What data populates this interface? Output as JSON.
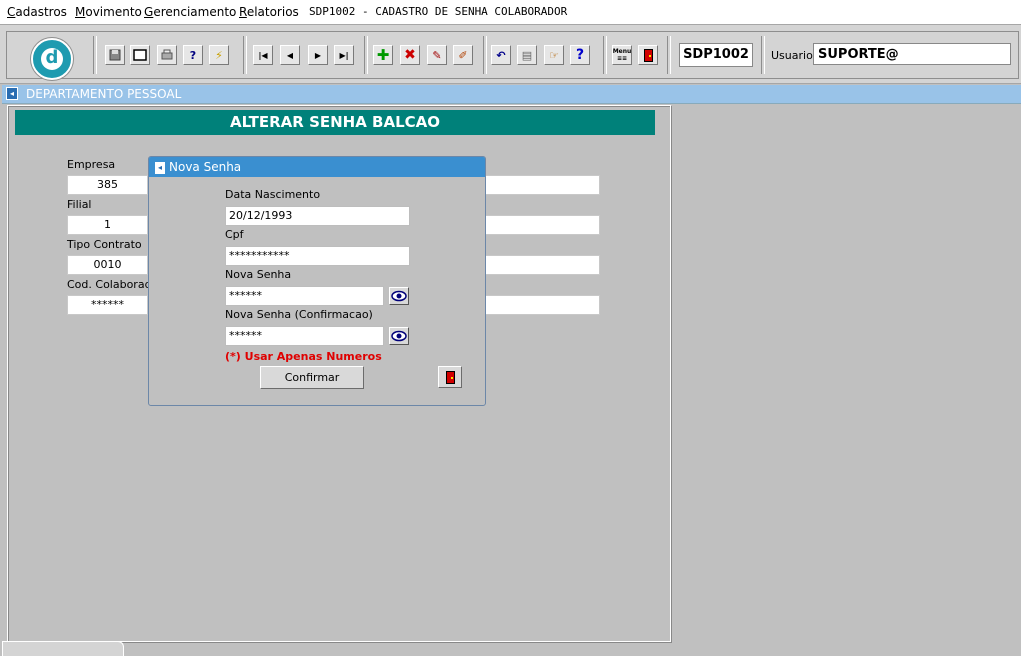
{
  "menu": {
    "items": [
      "Cadastros",
      "Movimento",
      "Gerenciamento",
      "Relatorios"
    ],
    "window_title": "SDP1002 - CADASTRO DE SENHA COLABORADOR"
  },
  "toolbar": {
    "logo_letter": "d",
    "form_code": "SDP1002",
    "user_label": "Usuario",
    "user_value": "SUPORTE@",
    "menu_icon_text": "Menu",
    "buttons": [
      "save-icon",
      "window-icon",
      "print-icon",
      "query-icon",
      "run-icon",
      "first-record-icon",
      "previous-record-icon",
      "next-record-icon",
      "last-record-icon",
      "add-record-icon",
      "delete-record-icon",
      "edit-record-icon",
      "clear-icon",
      "undo-icon",
      "clipboard-icon",
      "help-hand-icon",
      "help-icon",
      "menu-icon",
      "exit-icon"
    ]
  },
  "department": {
    "title": "DEPARTAMENTO PESSOAL"
  },
  "main": {
    "banner": "ALTERAR SENHA BALCAO",
    "fields": {
      "empresa": {
        "label": "Empresa",
        "value": "385"
      },
      "filial": {
        "label": "Filial",
        "value": "1"
      },
      "tipo_contrato": {
        "label": "Tipo Contrato",
        "value": "0010"
      },
      "cod_colaborador": {
        "label": "Cod. Colaborador",
        "value": "******"
      }
    }
  },
  "dialog": {
    "title": "Nova Senha",
    "data_nascimento": {
      "label": "Data Nascimento",
      "value": "20/12/1993"
    },
    "cpf": {
      "label": "Cpf",
      "value": "***********"
    },
    "nova_senha": {
      "label": "Nova Senha",
      "value": "******"
    },
    "confirmacao": {
      "label": "Nova Senha (Confirmacao)",
      "value": "******"
    },
    "note": "(*) Usar Apenas Numeros",
    "confirm_label": "Confirmar"
  },
  "colors": {
    "banner": "#00817a",
    "dialog_title": "#3a8fd0",
    "note": "#e00000"
  }
}
